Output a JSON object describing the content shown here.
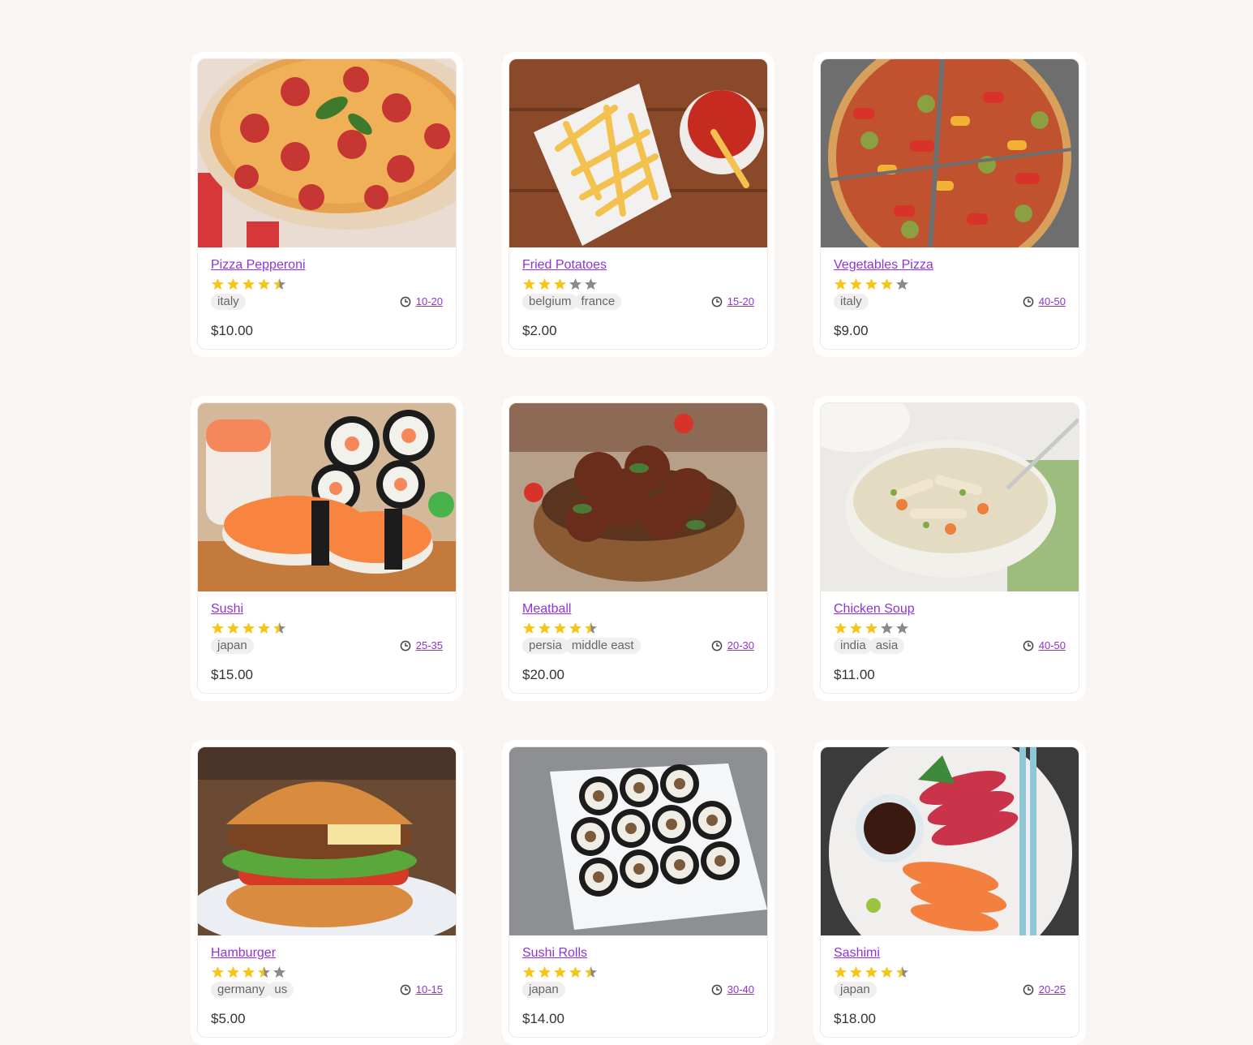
{
  "colors": {
    "background": "#f8f5f3",
    "link": "#8f33d6",
    "star_filled": "#f5c518",
    "star_empty": "#8a8a8a"
  },
  "cards": [
    {
      "name": "Pizza Pepperoni",
      "rating": 4.5,
      "tags": [
        "italy"
      ],
      "time": "10-20",
      "price": "$10.00",
      "image_icon": "pizza-pepperoni-photo"
    },
    {
      "name": "Fried Potatoes",
      "rating": 3,
      "tags": [
        "belgium",
        "france"
      ],
      "time": "15-20",
      "price": "$2.00",
      "image_icon": "fried-potatoes-photo"
    },
    {
      "name": "Vegetables Pizza",
      "rating": 4,
      "tags": [
        "italy"
      ],
      "time": "40-50",
      "price": "$9.00",
      "image_icon": "vegetables-pizza-photo"
    },
    {
      "name": "Sushi",
      "rating": 4.5,
      "tags": [
        "japan"
      ],
      "time": "25-35",
      "price": "$15.00",
      "image_icon": "sushi-photo"
    },
    {
      "name": "Meatball",
      "rating": 4.5,
      "tags": [
        "persia",
        "middle east"
      ],
      "time": "20-30",
      "price": "$20.00",
      "image_icon": "meatball-photo"
    },
    {
      "name": "Chicken Soup",
      "rating": 3,
      "tags": [
        "india",
        "asia"
      ],
      "time": "40-50",
      "price": "$11.00",
      "image_icon": "chicken-soup-photo"
    },
    {
      "name": "Hamburger",
      "rating": 3.5,
      "tags": [
        "germany",
        "us"
      ],
      "time": "10-15",
      "price": "$5.00",
      "image_icon": "hamburger-photo"
    },
    {
      "name": "Sushi Rolls",
      "rating": 4.5,
      "tags": [
        "japan"
      ],
      "time": "30-40",
      "price": "$14.00",
      "image_icon": "sushi-rolls-photo"
    },
    {
      "name": "Sashimi",
      "rating": 4.5,
      "tags": [
        "japan"
      ],
      "time": "20-25",
      "price": "$18.00",
      "image_icon": "sashimi-photo"
    }
  ]
}
